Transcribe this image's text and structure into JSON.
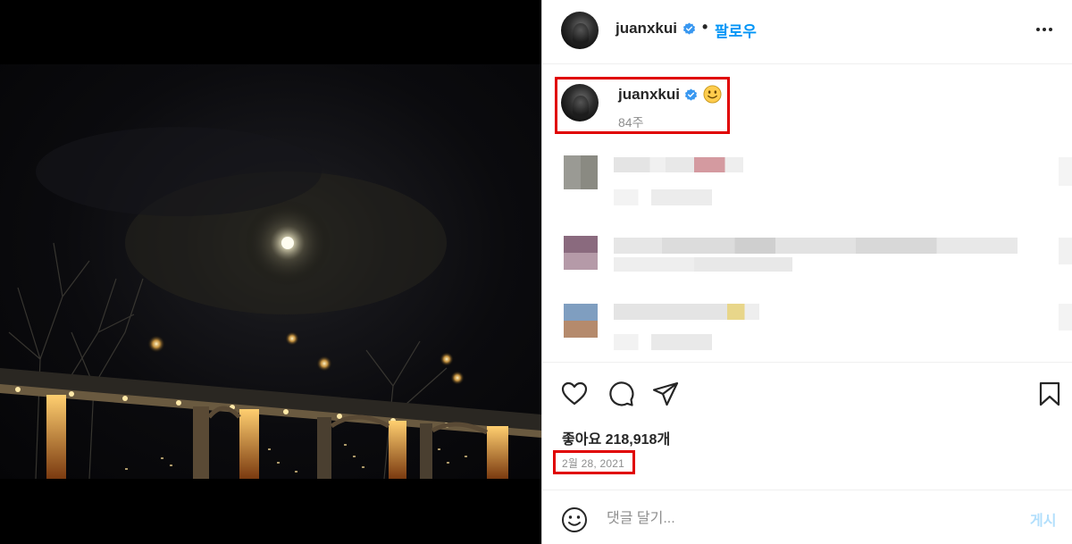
{
  "media": {
    "description_icon": "night-moon-bridge-photo"
  },
  "header": {
    "username": "juanxkui",
    "separator": "•",
    "follow_label": "팔로우",
    "more_icon": "more-horizontal-icon"
  },
  "caption": {
    "username": "juanxkui",
    "emoji": "slightly-smiling-face-icon",
    "age": "84주"
  },
  "actions": {
    "like_icon": "heart-icon",
    "comment_icon": "comment-icon",
    "share_icon": "send-icon",
    "save_icon": "bookmark-icon"
  },
  "likes": {
    "label": "좋아요 218,918개"
  },
  "post_date": "2월 28, 2021",
  "comment_box": {
    "placeholder": "댓글 달기...",
    "post_label": "게시"
  },
  "colors": {
    "accent": "#0095f6",
    "verified": "#3897f0",
    "highlight": "#e00000",
    "post_disabled": "#b2dffc"
  }
}
